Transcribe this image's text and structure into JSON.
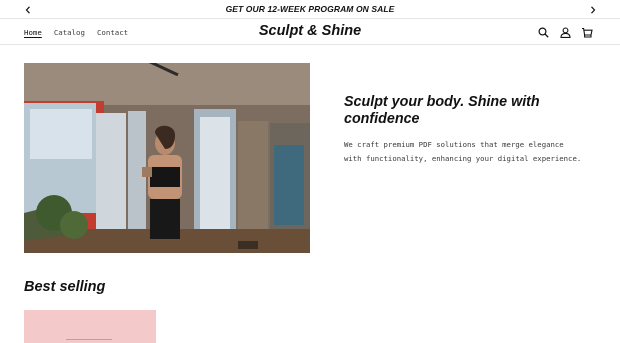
{
  "announcement": {
    "message": "GET OUR 12-WEEK PROGRAM ON SALE",
    "prev_icon": "chevron-left-icon",
    "next_icon": "chevron-right-icon"
  },
  "header": {
    "nav": [
      {
        "label": "Home",
        "active": true
      },
      {
        "label": "Catalog",
        "active": false
      },
      {
        "label": "Contact",
        "active": false
      }
    ],
    "logo": "Sculpt & Shine",
    "icons": [
      "search-icon",
      "account-icon",
      "cart-icon"
    ]
  },
  "hero": {
    "image": "woman-in-sports-bra-with-dumbbell-in-apartment",
    "title": "Sculpt your body. Shine with confidence",
    "description": "We craft premium PDF solutions that merge elegance with functionality, enhancing your digital experience."
  },
  "best_selling": {
    "title": "Best selling"
  },
  "colors": {
    "text": "#121212",
    "card": "#f3c9c9",
    "divider": "#e6e6e6"
  }
}
